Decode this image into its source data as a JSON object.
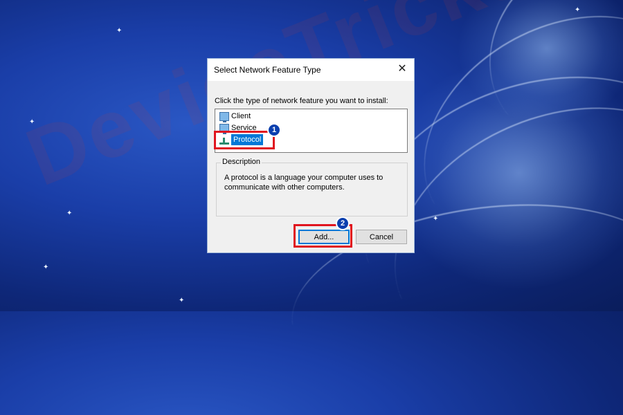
{
  "watermark": "DeviceTricks",
  "dialog": {
    "title": "Select Network Feature Type",
    "close_glyph": "✕",
    "instruction": "Click the type of network feature you want to install:",
    "items": [
      {
        "label": "Client",
        "icon": "client-icon"
      },
      {
        "label": "Service",
        "icon": "service-icon"
      },
      {
        "label": "Protocol",
        "icon": "protocol-icon",
        "selected": true
      }
    ],
    "description_legend": "Description",
    "description_text": "A protocol is a language your computer uses to communicate with other computers.",
    "add_label": "Add...",
    "cancel_label": "Cancel"
  },
  "annotations": {
    "step1": "1",
    "step2": "2",
    "highlight_color": "#e0141e",
    "badge_color": "#0a3fae"
  }
}
